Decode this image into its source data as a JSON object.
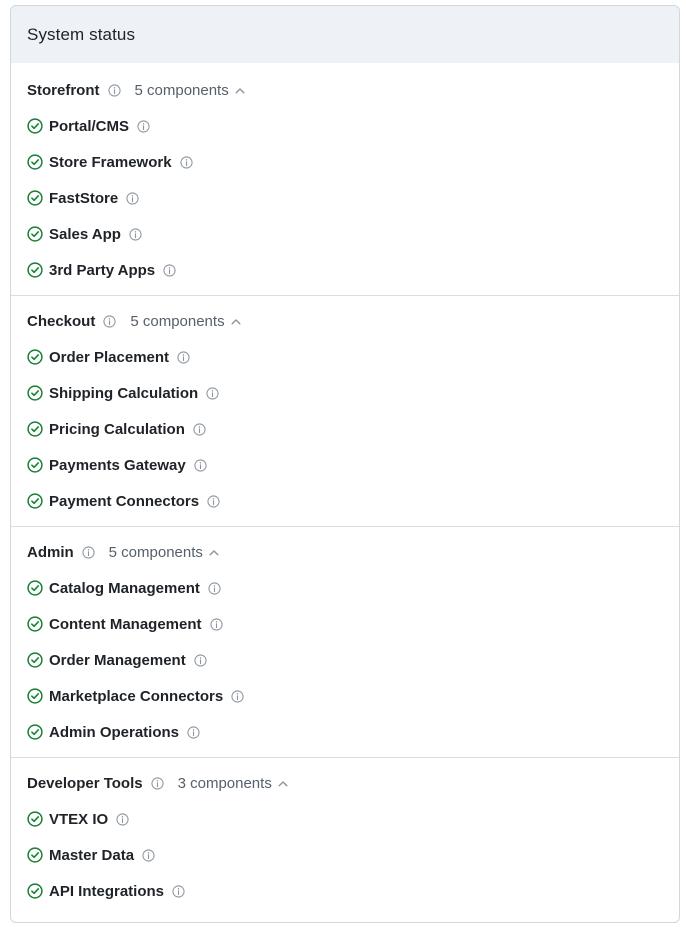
{
  "panel": {
    "title": "System status"
  },
  "colors": {
    "ok": "#1a7f37",
    "muted": "#8c959f",
    "header_bg": "#eef2f6"
  },
  "icons": {
    "status": "check-circle-icon",
    "info": "info-icon",
    "toggle": "chevron-up-icon"
  },
  "groups": [
    {
      "name": "Storefront",
      "count_label": "5 components",
      "items": [
        {
          "label": "Portal/CMS"
        },
        {
          "label": "Store Framework"
        },
        {
          "label": "FastStore"
        },
        {
          "label": "Sales App"
        },
        {
          "label": "3rd Party Apps"
        }
      ]
    },
    {
      "name": "Checkout",
      "count_label": "5 components",
      "items": [
        {
          "label": "Order Placement"
        },
        {
          "label": "Shipping Calculation"
        },
        {
          "label": "Pricing Calculation"
        },
        {
          "label": "Payments Gateway"
        },
        {
          "label": "Payment Connectors"
        }
      ]
    },
    {
      "name": "Admin",
      "count_label": "5 components",
      "items": [
        {
          "label": "Catalog Management"
        },
        {
          "label": "Content Management"
        },
        {
          "label": "Order Management"
        },
        {
          "label": "Marketplace Connectors"
        },
        {
          "label": "Admin Operations"
        }
      ]
    },
    {
      "name": "Developer Tools",
      "count_label": "3 components",
      "items": [
        {
          "label": "VTEX IO"
        },
        {
          "label": "Master Data"
        },
        {
          "label": "API Integrations"
        }
      ]
    }
  ]
}
